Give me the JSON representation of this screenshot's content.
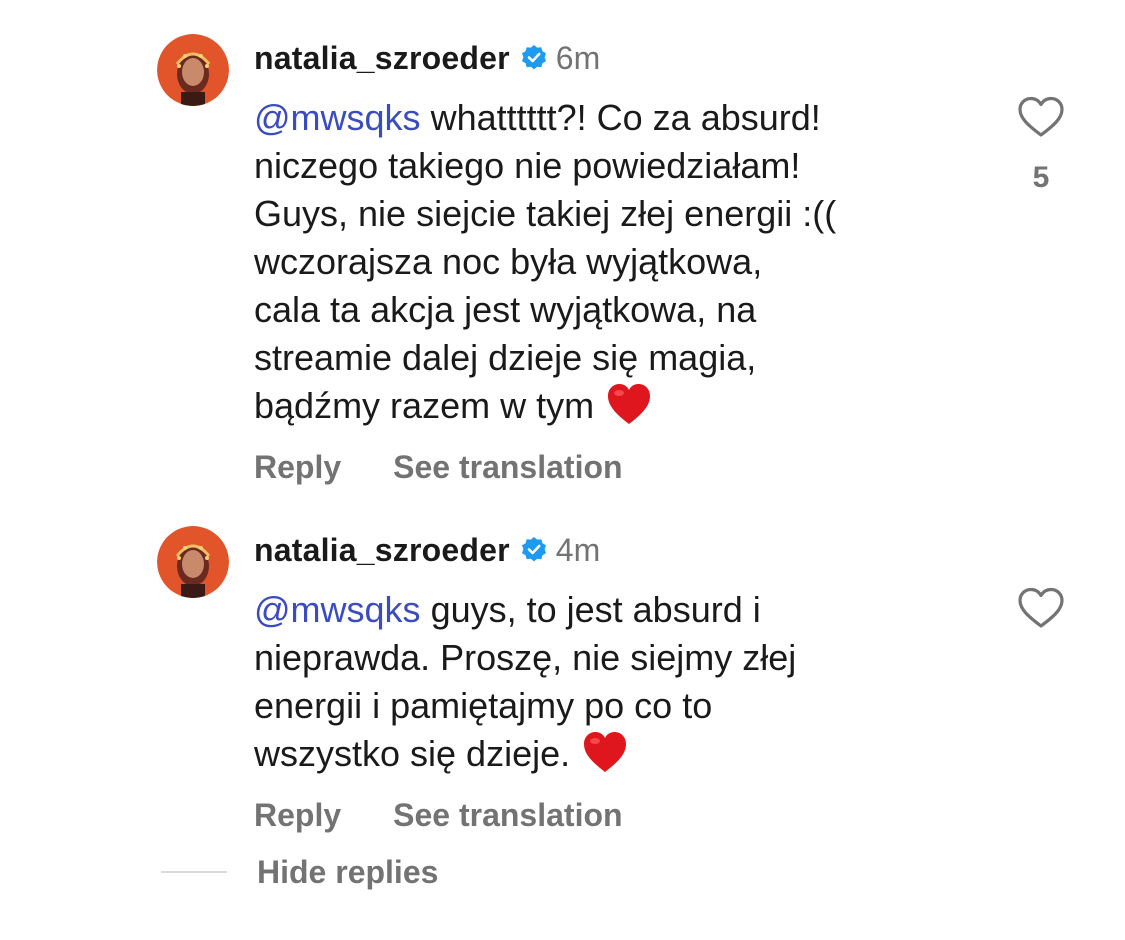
{
  "comments": [
    {
      "username": "natalia_szroeder",
      "verified": true,
      "time": "6m",
      "mention": "@mwsqks",
      "lines": [
        " whatttttt?! Co za absurd!",
        "niczego takiego nie powiedziałam!",
        "Guys, nie siejcie takiej złej energii :((",
        "wczorajsza noc była wyjątkowa,",
        "cala ta akcja jest wyjątkowa, na",
        "streamie dalej dzieje się magia,",
        "bądźmy razem w tym"
      ],
      "emoji": "red-heart",
      "likes": "5",
      "reply_label": "Reply",
      "translate_label": "See translation"
    },
    {
      "username": "natalia_szroeder",
      "verified": true,
      "time": "4m",
      "mention": "@mwsqks",
      "lines": [
        " guys, to jest absurd i",
        "nieprawda. Proszę, nie siejmy złej",
        "energii i pamiętajmy po co to",
        "wszystko się dzieje."
      ],
      "emoji": "red-heart",
      "reply_label": "Reply",
      "translate_label": "See translation"
    }
  ],
  "hide_replies_label": "Hide replies",
  "colors": {
    "text": "#1a1a1a",
    "secondary": "#737373",
    "mention": "#3b4cc0",
    "verified": "#1d9bf0",
    "heart": "#e0161e"
  }
}
